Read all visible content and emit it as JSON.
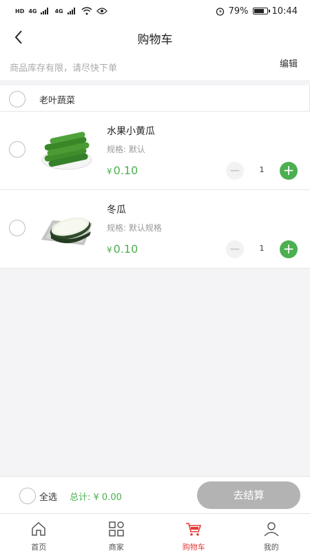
{
  "status_bar": {
    "left_badges": [
      "HD",
      "4G",
      "4G"
    ],
    "battery": "79%",
    "time": "10:44"
  },
  "header": {
    "title": "购物车"
  },
  "notice": {
    "text": "商品库存有限，请尽快下单",
    "edit_label": "编辑"
  },
  "shop": {
    "name": "老叶蔬菜"
  },
  "items": [
    {
      "name": "水果小黄瓜",
      "spec": "规格: 默认",
      "currency": "¥",
      "price": "0.10",
      "qty": "1"
    },
    {
      "name": "冬瓜",
      "spec": "规格: 默认规格",
      "currency": "¥",
      "price": "0.10",
      "qty": "1"
    }
  ],
  "checkout": {
    "select_all_label": "全选",
    "total_label": "总计: ¥ 0.00",
    "button_label": "去结算"
  },
  "tabs": [
    {
      "label": "首页",
      "icon": "home-icon"
    },
    {
      "label": "商家",
      "icon": "grid-icon"
    },
    {
      "label": "购物车",
      "icon": "cart-icon",
      "active": true
    },
    {
      "label": "我的",
      "icon": "user-icon"
    }
  ],
  "colors": {
    "accent_green": "#4caf50",
    "active_red": "#e53935",
    "button_gray": "#b3b3b3"
  }
}
